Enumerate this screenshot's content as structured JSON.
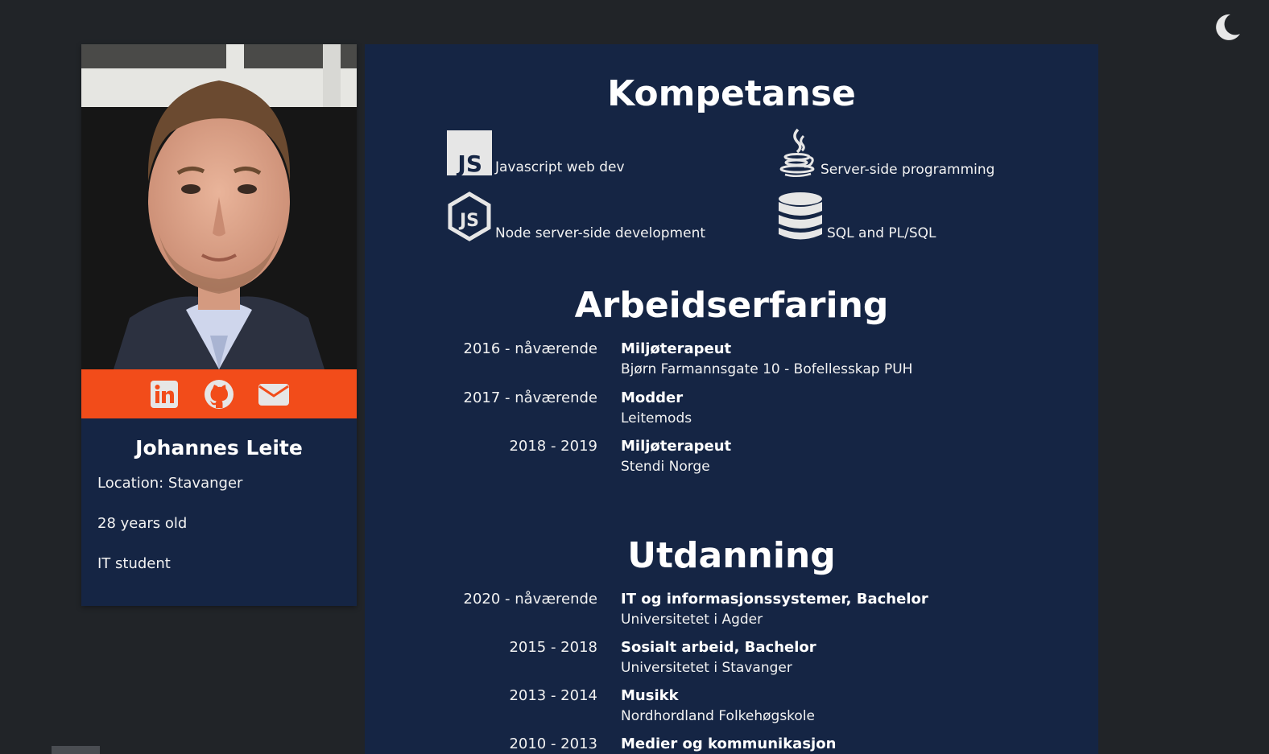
{
  "profile": {
    "name": "Johannes Leite",
    "location": "Location: Stavanger",
    "age": "28 years old",
    "occupation": "IT student"
  },
  "social": [
    {
      "name": "linkedin-icon"
    },
    {
      "name": "github-icon"
    },
    {
      "name": "email-icon"
    }
  ],
  "competence": {
    "title": "Kompetanse",
    "skills": [
      {
        "icon": "javascript-icon",
        "label": "Javascript web dev"
      },
      {
        "icon": "java-icon",
        "label": "Server-side programming"
      },
      {
        "icon": "nodejs-icon",
        "label": "Node server-side development"
      },
      {
        "icon": "database-icon",
        "label": "SQL and PL/SQL"
      }
    ]
  },
  "work": {
    "title": "Arbeidserfaring",
    "entries": [
      {
        "years": "2016 - nåværende",
        "title": "Miljøterapeut",
        "place": "Bjørn Farmannsgate 10 - Bofellesskap PUH"
      },
      {
        "years": "2017 - nåværende",
        "title": "Modder",
        "place": "Leitemods"
      },
      {
        "years": "2018 - 2019",
        "title": "Miljøterapeut",
        "place": "Stendi Norge"
      }
    ]
  },
  "education": {
    "title": "Utdanning",
    "entries": [
      {
        "years": "2020 - nåværende",
        "title": "IT og informasjonssystemer, Bachelor",
        "place": "Universitetet i Agder"
      },
      {
        "years": "2015 - 2018",
        "title": "Sosialt arbeid, Bachelor",
        "place": "Universitetet i Stavanger"
      },
      {
        "years": "2013 - 2014",
        "title": "Musikk",
        "place": "Nordhordland Folkehøgskole"
      },
      {
        "years": "2010 - 2013",
        "title": "Medier og kommunikasjon",
        "place": ""
      }
    ]
  },
  "theme": {
    "icon": "moon-icon"
  },
  "colors": {
    "background": "#212428",
    "panel": "#152544",
    "accent": "#f24c1a",
    "text": "#f2f2f2"
  }
}
